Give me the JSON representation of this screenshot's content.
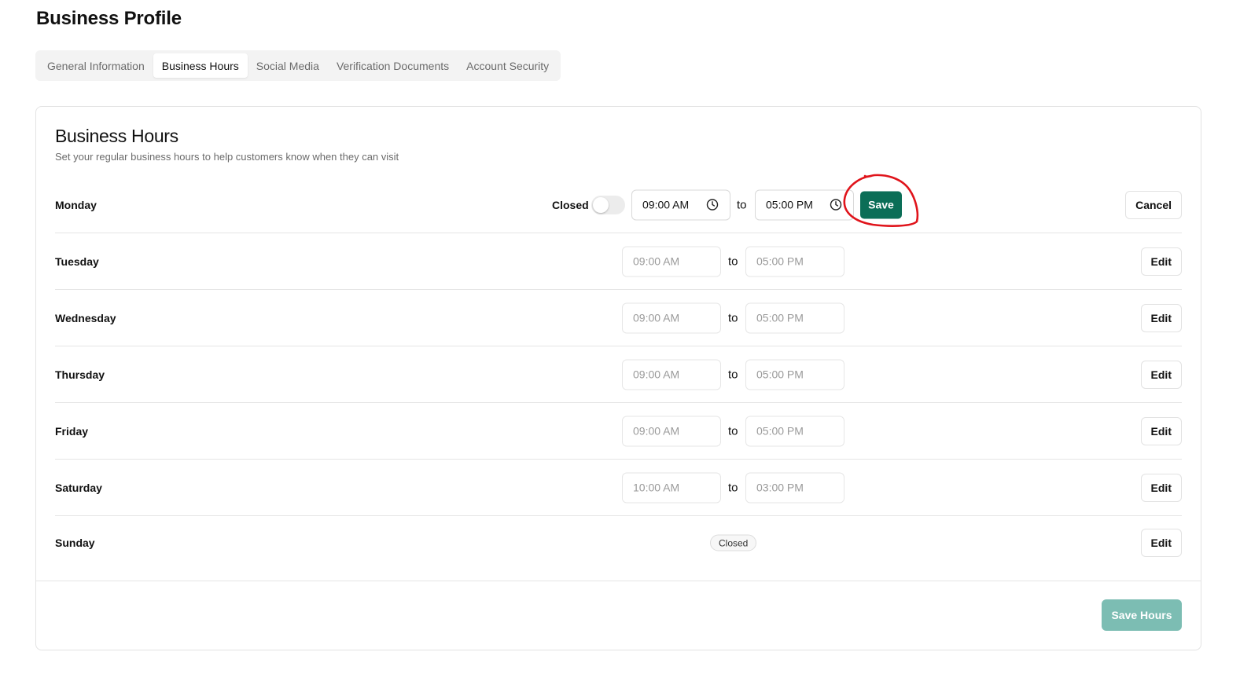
{
  "page": {
    "title": "Business Profile"
  },
  "tabs": [
    {
      "label": "General Information",
      "active": false
    },
    {
      "label": "Business Hours",
      "active": true
    },
    {
      "label": "Social Media",
      "active": false
    },
    {
      "label": "Verification Documents",
      "active": false
    },
    {
      "label": "Account Security",
      "active": false
    }
  ],
  "card": {
    "title": "Business Hours",
    "subtitle": "Set your regular business hours to help customers know when they can visit"
  },
  "separator_label": "to",
  "edit_row": {
    "day": "Monday",
    "closed_label": "Closed",
    "closed": false,
    "open_time": "09:00 AM",
    "close_time": "05:00 PM",
    "save_label": "Save",
    "cancel_label": "Cancel"
  },
  "days": [
    {
      "day": "Tuesday",
      "open": "09:00 AM",
      "close": "05:00 PM",
      "edit_label": "Edit"
    },
    {
      "day": "Wednesday",
      "open": "09:00 AM",
      "close": "05:00 PM",
      "edit_label": "Edit"
    },
    {
      "day": "Thursday",
      "open": "09:00 AM",
      "close": "05:00 PM",
      "edit_label": "Edit"
    },
    {
      "day": "Friday",
      "open": "09:00 AM",
      "close": "05:00 PM",
      "edit_label": "Edit"
    },
    {
      "day": "Saturday",
      "open": "10:00 AM",
      "close": "03:00 PM",
      "edit_label": "Edit"
    },
    {
      "day": "Sunday",
      "closed_badge": "Closed",
      "edit_label": "Edit"
    }
  ],
  "footer": {
    "save_hours_label": "Save Hours"
  },
  "colors": {
    "primary": "#0b6e57",
    "primary_disabled": "#7cbdb3",
    "annotation": "#e0141b"
  }
}
